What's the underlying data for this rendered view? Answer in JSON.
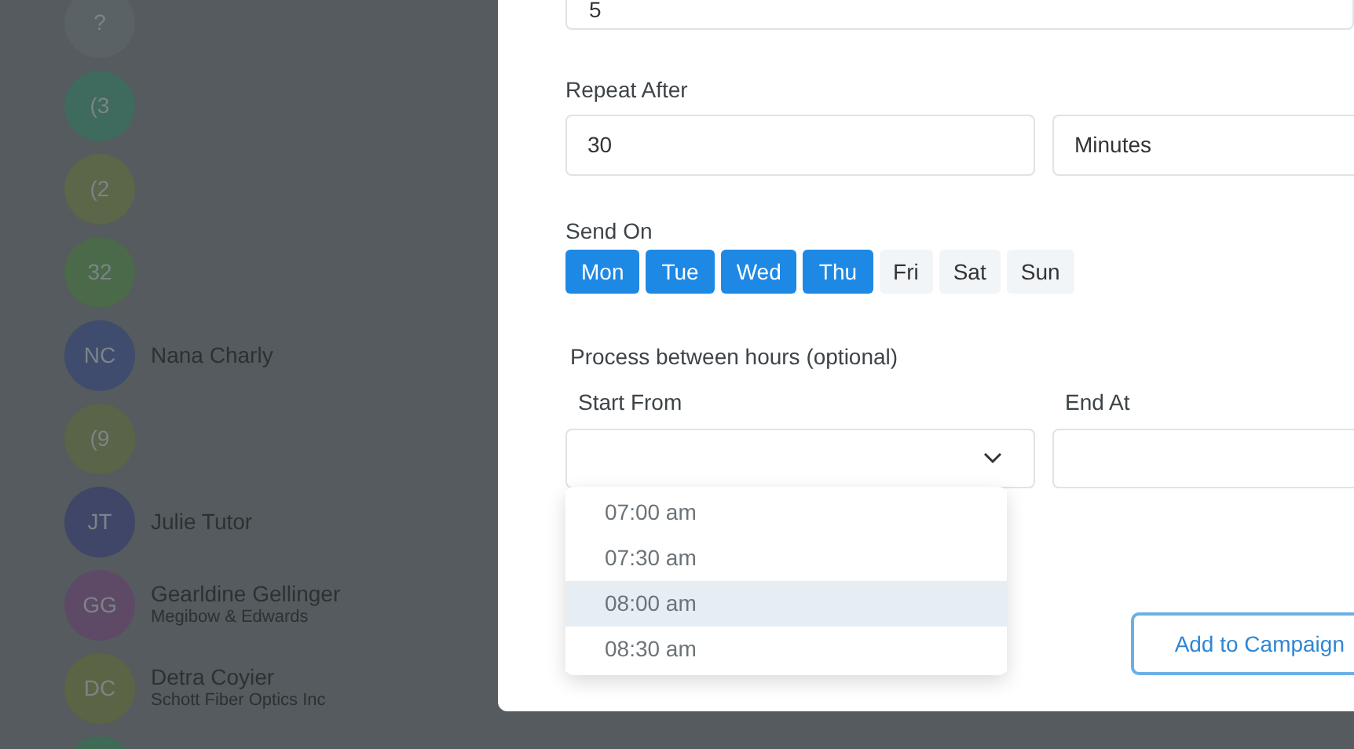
{
  "contacts": [
    {
      "initials": "?",
      "color": "#5a6266"
    },
    {
      "initials": "(3",
      "color": "#3f6a5e"
    },
    {
      "initials": "(2",
      "color": "#5c6649"
    },
    {
      "initials": "32",
      "color": "#4a6a4a"
    },
    {
      "initials": "NC",
      "name": "Nana Charly",
      "color": "#3f4c6e"
    },
    {
      "initials": "(9",
      "color": "#5a6448"
    },
    {
      "initials": "JT",
      "name": "Julie Tutor",
      "color": "#3f4668"
    },
    {
      "initials": "GG",
      "name": "Gearldine Gellinger",
      "company": "Megibow & Edwards",
      "color": "#5e4a66"
    },
    {
      "initials": "DC",
      "name": "Detra Coyier",
      "company": "Schott Fiber Optics Inc",
      "color": "#5b6545"
    },
    {
      "color": "#3f6a55"
    }
  ],
  "modal": {
    "count_field": {
      "value": "5"
    },
    "repeat_after": {
      "label": "Repeat After",
      "value": "30",
      "unit": "Minutes"
    },
    "send_on": {
      "label": "Send On",
      "days": [
        {
          "label": "Mon",
          "selected": true
        },
        {
          "label": "Tue",
          "selected": true
        },
        {
          "label": "Wed",
          "selected": true
        },
        {
          "label": "Thu",
          "selected": true
        },
        {
          "label": "Fri",
          "selected": false
        },
        {
          "label": "Sat",
          "selected": false
        },
        {
          "label": "Sun",
          "selected": false
        }
      ]
    },
    "hours": {
      "label": "Process between hours (optional)",
      "start_label": "Start From",
      "end_label": "End At",
      "options": [
        {
          "label": "07:00 am",
          "selected": false
        },
        {
          "label": "07:30 am",
          "selected": false
        },
        {
          "label": "08:00 am",
          "selected": true
        },
        {
          "label": "08:30 am",
          "selected": false
        }
      ]
    },
    "submit": "Add to Campaign"
  }
}
